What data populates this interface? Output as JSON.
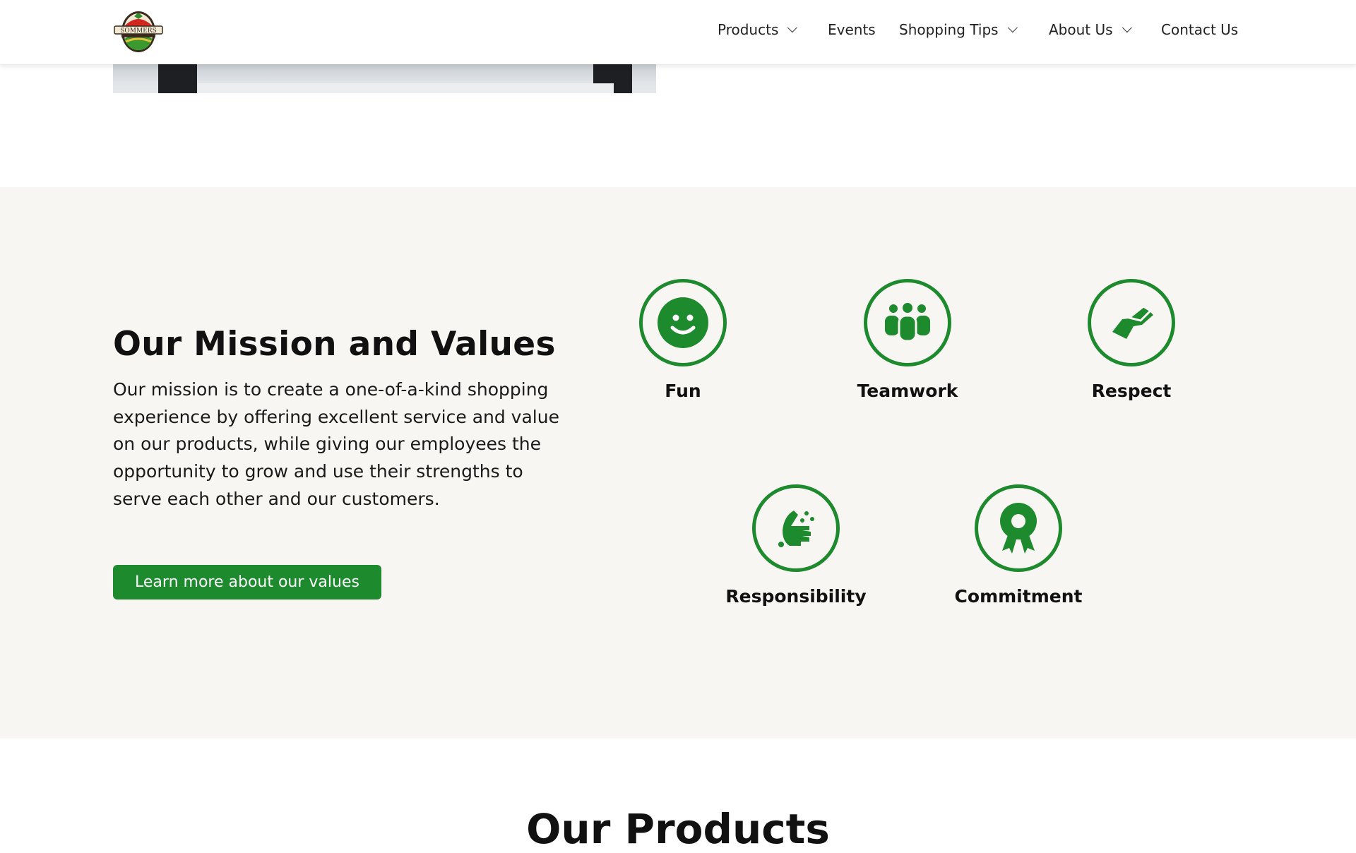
{
  "header": {
    "logo_text": "SOMMERS DISCOUNT MARKET",
    "nav": [
      {
        "label": "Products",
        "dropdown": true
      },
      {
        "label": "Events",
        "dropdown": false
      },
      {
        "label": "Shopping Tips",
        "dropdown": true
      },
      {
        "label": "About Us",
        "dropdown": true
      },
      {
        "label": "Contact Us",
        "dropdown": false
      }
    ]
  },
  "mission": {
    "title": "Our Mission and Values",
    "text": "Our mission is to create a one-of-a-kind shopping experience by offering excellent service and value on our products, while giving our employees the opportunity to grow and use their strengths to serve each other and our customers.",
    "button": "Learn more about our values",
    "values": [
      {
        "label": "Fun",
        "icon": "smiley-icon"
      },
      {
        "label": "Teamwork",
        "icon": "team-icon"
      },
      {
        "label": "Respect",
        "icon": "handshake-icon"
      },
      {
        "label": "Responsibility",
        "icon": "hand-washing-icon"
      },
      {
        "label": "Commitment",
        "icon": "award-ribbon-icon"
      }
    ]
  },
  "products": {
    "title": "Our Products"
  },
  "colors": {
    "accent": "#1e8a2e",
    "section_bg": "#f8f6f2"
  }
}
